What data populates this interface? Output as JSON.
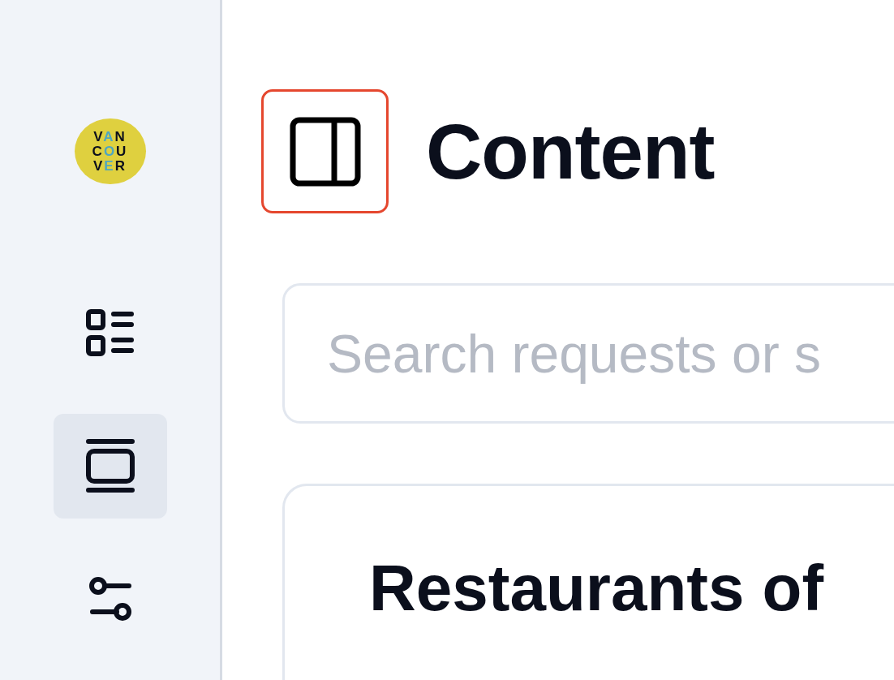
{
  "sidebar": {
    "logo": {
      "lines": [
        "VAN",
        "COU",
        "VER"
      ]
    },
    "items": [
      {
        "kind": "list",
        "selected": false
      },
      {
        "kind": "panel",
        "selected": true
      },
      {
        "kind": "sliders",
        "selected": false
      }
    ]
  },
  "header": {
    "title": "Content"
  },
  "search": {
    "placeholder": "Search requests or s"
  },
  "card": {
    "title": "Restaurants of"
  }
}
